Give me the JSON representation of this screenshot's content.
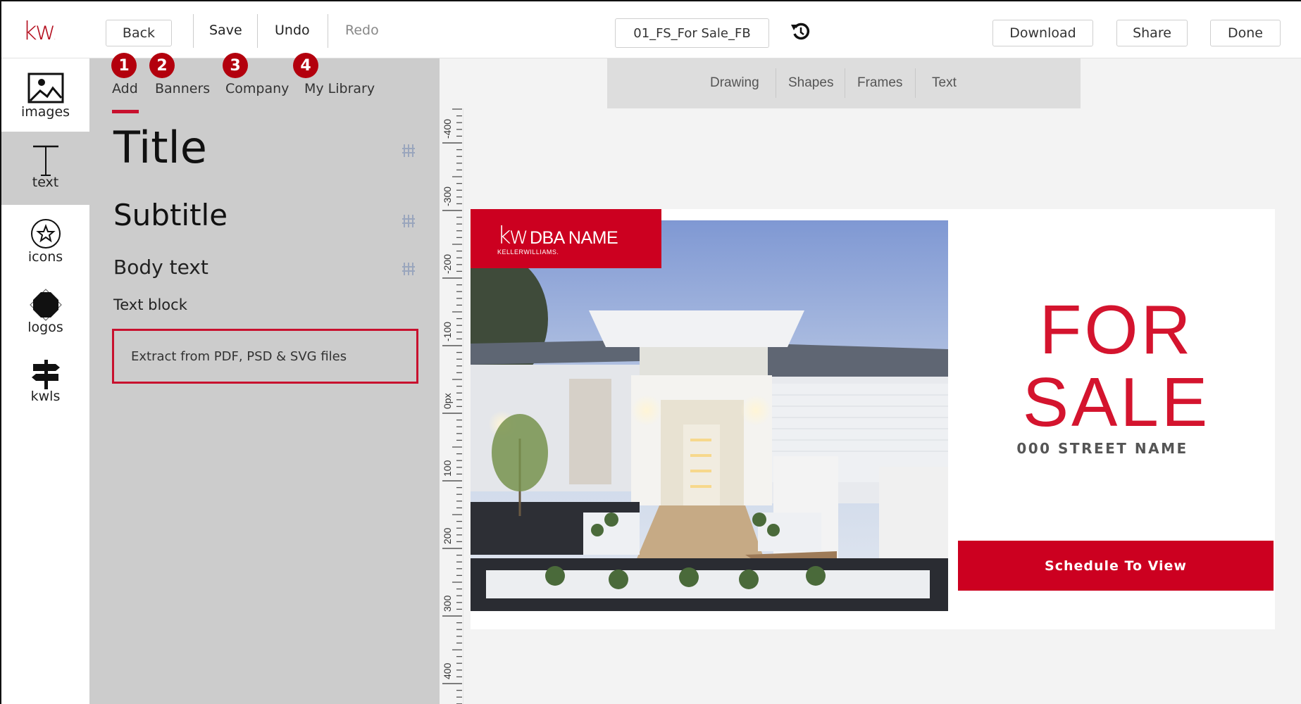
{
  "header": {
    "logo": "kw",
    "back_label": "Back",
    "save_label": "Save",
    "undo_label": "Undo",
    "redo_label": "Redo",
    "filename": "01_FS_For Sale_FB",
    "history_icon": "history-icon",
    "download_label": "Download",
    "share_label": "Share",
    "done_label": "Done"
  },
  "leftnav": {
    "items": [
      {
        "label": "images",
        "icon": "image-icon",
        "active": false
      },
      {
        "label": "text",
        "icon": "text-icon",
        "active": true
      },
      {
        "label": "icons",
        "icon": "star-circle-icon",
        "active": false
      },
      {
        "label": "logos",
        "icon": "octagon-logo-icon",
        "active": false
      },
      {
        "label": "kwls",
        "icon": "signpost-icon",
        "active": false
      }
    ]
  },
  "panel": {
    "tabs": [
      {
        "label": "Add",
        "marker": "1",
        "active": true
      },
      {
        "label": "Banners",
        "marker": "2",
        "active": false
      },
      {
        "label": "Company",
        "marker": "3",
        "active": false
      },
      {
        "label": "My Library",
        "marker": "4",
        "active": false
      }
    ],
    "text_styles": [
      {
        "label": "Title",
        "has_adjust": true
      },
      {
        "label": "Subtitle",
        "has_adjust": true
      },
      {
        "label": "Body text",
        "has_adjust": true
      },
      {
        "label": "Text block",
        "has_adjust": false
      }
    ],
    "extract_label": "Extract from PDF, PSD & SVG files"
  },
  "subtoolbar": {
    "items": [
      "Drawing",
      "Shapes",
      "Frames",
      "Text"
    ]
  },
  "ruler": {
    "labels": [
      "-400",
      "-300",
      "-200",
      "-100",
      "0px",
      "100",
      "200",
      "300",
      "400"
    ]
  },
  "flyer": {
    "brand_kw": "kw",
    "brand_name": "DBA NAME",
    "brand_sub": "KELLERWILLIAMS.",
    "headline_line1": "FOR",
    "headline_line2": "SALE",
    "street": "000 STREET NAME",
    "cta_label": "Schedule To View"
  },
  "colors": {
    "brand_red": "#cc0020",
    "accent_red": "#c8102e",
    "panel_gray": "#cccccc",
    "canvas_bg": "#f3f3f3",
    "marker_red": "#b3000d"
  }
}
